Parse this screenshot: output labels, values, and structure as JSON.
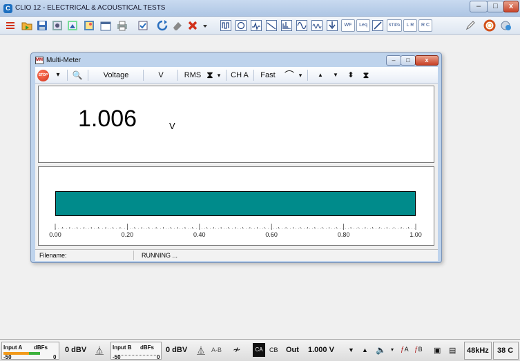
{
  "app": {
    "title": "CLIO 12 - ELECTRICAL & ACOUSTICAL TESTS",
    "logo_glyph": "C",
    "window_buttons": {
      "minimize": "–",
      "maximize": "□",
      "close": "x"
    }
  },
  "toolbar": {
    "icons": [
      "menu-icon",
      "open-icon",
      "save-icon",
      "settings-icon",
      "export-icon",
      "image-icon",
      "print-icon",
      "checkbox-icon",
      "refresh-icon",
      "eraser-icon",
      "cancel-icon",
      "oscilloscope-icon",
      "loop-icon",
      "sweep-icon",
      "filter-icon",
      "fft-icon",
      "sine-icon",
      "sweep-alt-icon",
      "probe-icon",
      "wf-icon",
      "leq-icon",
      "slope-icon",
      "stipa-icon",
      "lr-icon",
      "rc-icon",
      "pen-icon",
      "help-icon",
      "update-icon"
    ],
    "labels": {
      "wf": "WF",
      "leq": "Leq",
      "stipa": "STIPA",
      "lr": "L R",
      "rc": "R C"
    }
  },
  "multimeter": {
    "title": "Multi-Meter",
    "icon_glyph": "MM",
    "window_buttons": {
      "minimize": "–",
      "maximize": "□",
      "close": "x"
    },
    "toolbar": {
      "stop_label": "STOP",
      "dropdown_glyph": "▾",
      "zoom_glyph": "🔍",
      "parameter": "Voltage",
      "unit": "V",
      "mode": "RMS",
      "channel": "CH A",
      "speed": "Fast",
      "line_glyph": "⌒",
      "up_glyph": "▲",
      "down_glyph": "▼",
      "updown_glyph": "⬍",
      "range_glyph": "⧗"
    },
    "reading": {
      "value": "1.006",
      "unit": "V"
    },
    "bar": {
      "value": 1.006,
      "min": 0,
      "max": 1.0,
      "scale_labels": [
        "0.00",
        "0.20",
        "0.40",
        "0.60",
        "0.80",
        "1.00"
      ],
      "fill_color": "#008b8b"
    },
    "status": {
      "filename_label": "Filename:",
      "state": "RUNNING ..."
    }
  },
  "bottom": {
    "input_a": {
      "label": "Input A",
      "unit": "dBFs",
      "min": "-50",
      "max": "0",
      "level": 0.48
    },
    "input_a_value": "0 dBV",
    "input_b": {
      "label": "Input B",
      "unit": "dBFs",
      "min": "-50",
      "max": "0",
      "level": 0
    },
    "input_b_value": "0 dBV",
    "ab_label": "A-B",
    "ca_label": "CA",
    "cb_label": "CB",
    "out_label": "Out",
    "out_value": "1.000 V",
    "fa_label": "A",
    "fb_label": "B",
    "sample_rate": "48kHz",
    "temperature": "38 C"
  }
}
